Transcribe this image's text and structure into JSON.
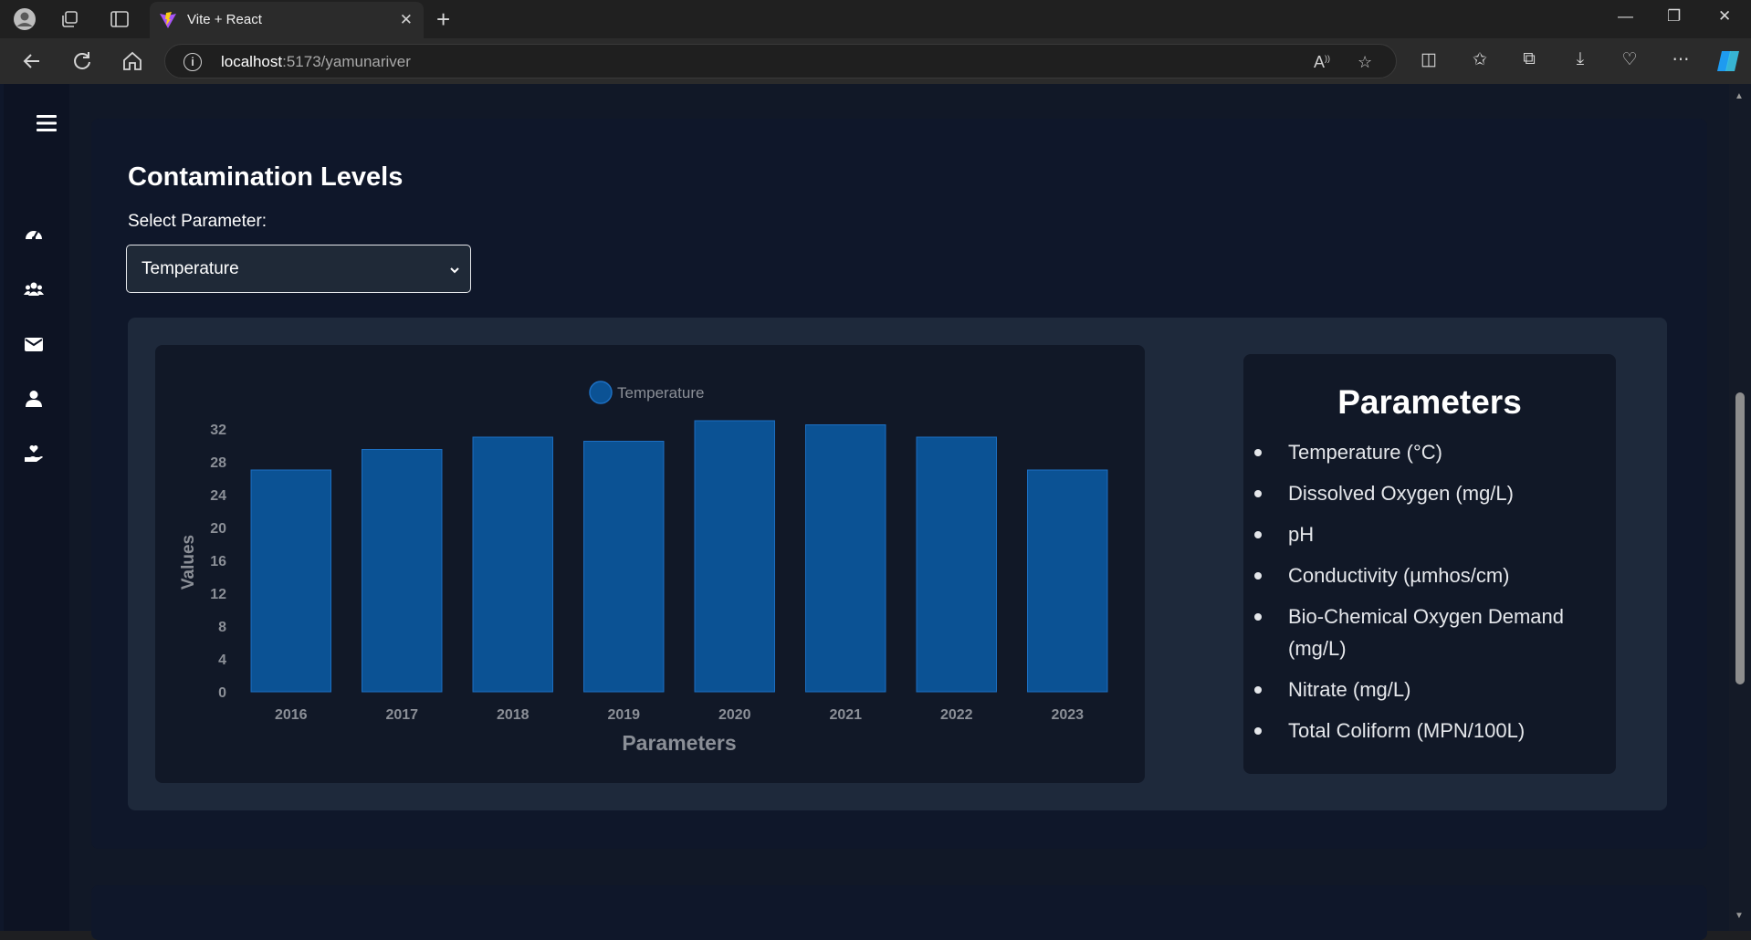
{
  "browser": {
    "tab_title": "Vite + React",
    "url_host": "localhost",
    "url_path": ":5173/yamunariver"
  },
  "page": {
    "title": "Contamination Levels",
    "select_label": "Select Parameter:",
    "selected_parameter": "Temperature"
  },
  "sidebar": {
    "icons": [
      "menu-icon",
      "dashboard-icon",
      "users-icon",
      "mail-icon",
      "user-icon",
      "donate-icon"
    ]
  },
  "parameters_panel": {
    "title": "Parameters",
    "items": [
      "Temperature (°C)",
      "Dissolved Oxygen (mg/L)",
      "pH",
      "Conductivity (µmhos/cm)",
      "Bio-Chemical Oxygen Demand (mg/L)",
      "Nitrate (mg/L)",
      "Total Coliform (MPN/100L)"
    ]
  },
  "chart_data": {
    "type": "bar",
    "categories": [
      "2016",
      "2017",
      "2018",
      "2019",
      "2020",
      "2021",
      "2022",
      "2023"
    ],
    "series": [
      {
        "name": "Temperature",
        "values": [
          27,
          29.5,
          31,
          30.5,
          33,
          32.5,
          31,
          27
        ]
      }
    ],
    "xlabel": "Parameters",
    "ylabel": "Values",
    "ylim": [
      0,
      32
    ],
    "yticks": [
      0,
      4,
      8,
      12,
      16,
      20,
      24,
      28,
      32
    ],
    "legend": "top-center",
    "grid": false,
    "colors": {
      "bar_fill": "#0b5294",
      "bar_stroke": "#1d6fc2",
      "tick_text": "#8b8f97"
    }
  }
}
